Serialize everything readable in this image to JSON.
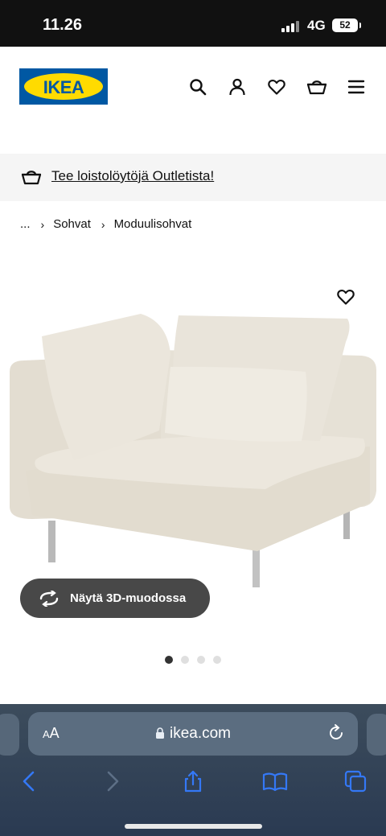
{
  "status_bar": {
    "time": "11.26",
    "network": "4G",
    "battery": "52"
  },
  "header": {
    "logo_text": "IKEA",
    "icons": [
      "search-icon",
      "user-icon",
      "heart-icon",
      "cart-icon",
      "menu-icon"
    ]
  },
  "promo": {
    "text": "Tee loistolöytöjä Outletista!"
  },
  "breadcrumb": {
    "items": [
      {
        "label": "..."
      },
      {
        "label": "Sohvat"
      },
      {
        "label": "Moduulisohvat"
      }
    ]
  },
  "product": {
    "view_3d_label": "Näytä 3D-muodossa",
    "image_count": 4,
    "active_image": 1
  },
  "browser": {
    "aa_label_small": "A",
    "aa_label": "A",
    "url": "ikea.com"
  },
  "colors": {
    "brand_blue": "#0058a3",
    "brand_yellow": "#ffdb00",
    "sofa": "#e9e4da",
    "browser_accent": "#3478f6"
  }
}
